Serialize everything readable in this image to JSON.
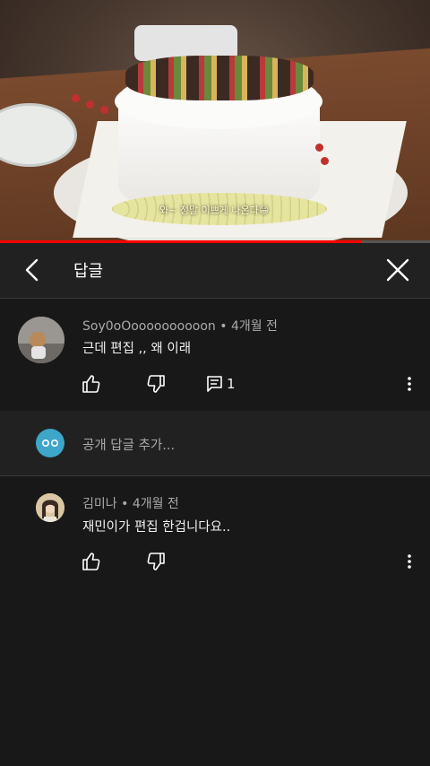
{
  "video": {
    "overlay_text": "와~ 정말 이쁘게 나온다😁",
    "progress_fraction": 0.84
  },
  "header": {
    "title": "답글",
    "back_icon": "chevron-left-icon",
    "close_icon": "close-icon"
  },
  "thread_comment": {
    "author": "Soy0oOoooooooooon",
    "time": "4개월 전",
    "separator": "•",
    "text": "근데 편집 ,, 왜 이래",
    "reply_count": "1"
  },
  "add_reply": {
    "placeholder": "공개 답글 추가..."
  },
  "reply": {
    "author": "김미나",
    "time": "4개월 전",
    "separator": "•",
    "text": "재민이가 편집 한겁니다요.."
  },
  "colors": {
    "background": "#181818",
    "header_bg": "#212121",
    "progress": "#ff0000",
    "user_avatar": "#3ea6c8",
    "secondary_text": "#aaaaaa"
  }
}
